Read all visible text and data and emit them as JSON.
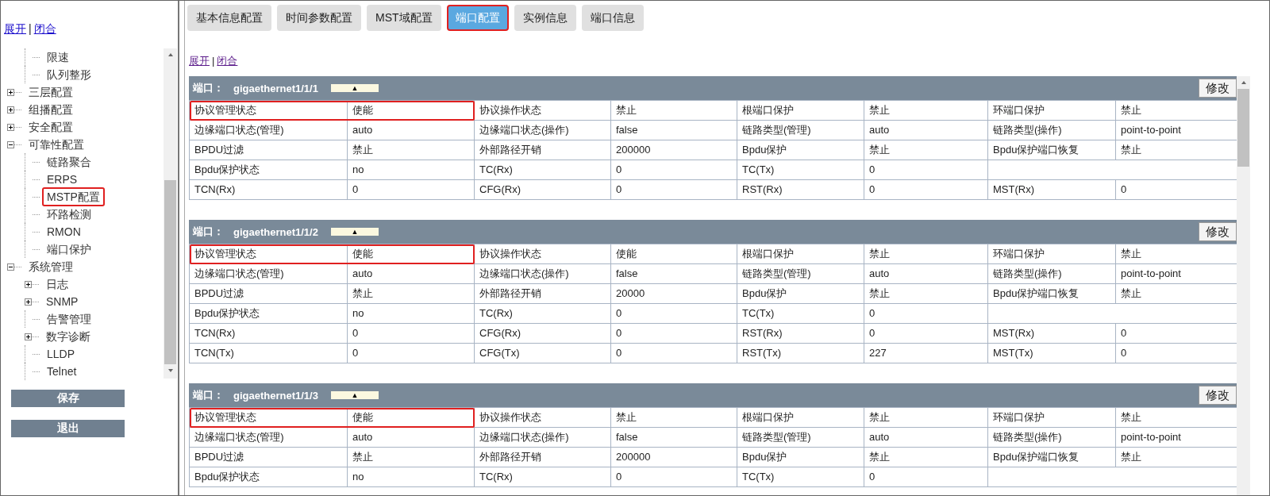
{
  "sidebar": {
    "links": [
      "展开",
      "闭合"
    ],
    "separator": "|",
    "tree": [
      {
        "children": [
          {
            "label": "限速",
            "highlighted": false
          },
          {
            "label": "队列整形",
            "highlighted": false
          }
        ]
      },
      {
        "label": "三层配置",
        "expanded": false,
        "highlighted": false
      },
      {
        "label": "组播配置",
        "expanded": false,
        "highlighted": false
      },
      {
        "label": "安全配置",
        "expanded": false,
        "highlighted": false
      },
      {
        "label": "可靠性配置",
        "expanded": true,
        "highlighted": false,
        "children": [
          {
            "label": "链路聚合",
            "highlighted": false
          },
          {
            "label": "ERPS",
            "highlighted": false
          },
          {
            "label": "MSTP配置",
            "highlighted": true
          },
          {
            "label": "环路检测",
            "highlighted": false
          },
          {
            "label": "RMON",
            "highlighted": false
          },
          {
            "label": "端口保护",
            "highlighted": false
          }
        ]
      },
      {
        "label": "系统管理",
        "expanded": true,
        "highlighted": false,
        "children": [
          {
            "label": "日志",
            "expanded": false,
            "highlighted": false
          },
          {
            "label": "SNMP",
            "expanded": false,
            "highlighted": false
          },
          {
            "label": "告警管理",
            "highlighted": false
          },
          {
            "label": "数字诊断",
            "expanded": false,
            "highlighted": false
          },
          {
            "label": "LLDP",
            "highlighted": false
          },
          {
            "label": "Telnet",
            "highlighted": false
          }
        ]
      }
    ],
    "buttons": [
      "保存",
      "退出"
    ]
  },
  "tabs": [
    {
      "label": "基本信息配置",
      "selected": false,
      "highlighted": false
    },
    {
      "label": "时间参数配置",
      "selected": false,
      "highlighted": false
    },
    {
      "label": "MST域配置",
      "selected": false,
      "highlighted": false
    },
    {
      "label": "端口配置",
      "selected": true,
      "highlighted": true
    },
    {
      "label": "实例信息",
      "selected": false,
      "highlighted": false
    },
    {
      "label": "端口信息",
      "selected": false,
      "highlighted": false
    }
  ],
  "links": [
    "展开",
    "闭合"
  ],
  "separator": "|",
  "ports": [
    {
      "label": "端口：",
      "name": "gigaethernet1/1/1",
      "toggle": "▲",
      "action": "修改",
      "rows": [
        {
          "highlighted": true,
          "cells": [
            "协议管理状态",
            "使能",
            "协议操作状态",
            "禁止",
            "根端口保护",
            "禁止",
            "环端口保护",
            "禁止"
          ]
        },
        {
          "highlighted": false,
          "cells": [
            "边缘端口状态(管理)",
            "auto",
            "边缘端口状态(操作)",
            "false",
            "链路类型(管理)",
            "auto",
            "链路类型(操作)",
            "point-to-point"
          ]
        },
        {
          "highlighted": false,
          "cells": [
            "BPDU过滤",
            "禁止",
            "外部路径开销",
            "200000",
            "Bpdu保护",
            "禁止",
            "Bpdu保护端口恢复",
            "禁止"
          ]
        },
        {
          "highlighted": false,
          "cells": [
            "Bpdu保护状态",
            "no",
            "TC(Rx)",
            "0",
            "TC(Tx)",
            "0"
          ]
        },
        {
          "highlighted": false,
          "cells": [
            "TCN(Rx)",
            "0",
            "CFG(Rx)",
            "0",
            "RST(Rx)",
            "0",
            "MST(Rx)",
            "0"
          ]
        }
      ]
    },
    {
      "label": "端口：",
      "name": "gigaethernet1/1/2",
      "toggle": "▲",
      "action": "修改",
      "rows": [
        {
          "highlighted": true,
          "cells": [
            "协议管理状态",
            "使能",
            "协议操作状态",
            "使能",
            "根端口保护",
            "禁止",
            "环端口保护",
            "禁止"
          ]
        },
        {
          "highlighted": false,
          "cells": [
            "边缘端口状态(管理)",
            "auto",
            "边缘端口状态(操作)",
            "false",
            "链路类型(管理)",
            "auto",
            "链路类型(操作)",
            "point-to-point"
          ]
        },
        {
          "highlighted": false,
          "cells": [
            "BPDU过滤",
            "禁止",
            "外部路径开销",
            "20000",
            "Bpdu保护",
            "禁止",
            "Bpdu保护端口恢复",
            "禁止"
          ]
        },
        {
          "highlighted": false,
          "cells": [
            "Bpdu保护状态",
            "no",
            "TC(Rx)",
            "0",
            "TC(Tx)",
            "0"
          ]
        },
        {
          "highlighted": false,
          "cells": [
            "TCN(Rx)",
            "0",
            "CFG(Rx)",
            "0",
            "RST(Rx)",
            "0",
            "MST(Rx)",
            "0"
          ]
        },
        {
          "highlighted": false,
          "cells": [
            "TCN(Tx)",
            "0",
            "CFG(Tx)",
            "0",
            "RST(Tx)",
            "227",
            "MST(Tx)",
            "0"
          ]
        }
      ]
    },
    {
      "label": "端口：",
      "name": "gigaethernet1/1/3",
      "toggle": "▲",
      "action": "修改",
      "rows": [
        {
          "highlighted": true,
          "cells": [
            "协议管理状态",
            "使能",
            "协议操作状态",
            "禁止",
            "根端口保护",
            "禁止",
            "环端口保护",
            "禁止"
          ]
        },
        {
          "highlighted": false,
          "cells": [
            "边缘端口状态(管理)",
            "auto",
            "边缘端口状态(操作)",
            "false",
            "链路类型(管理)",
            "auto",
            "链路类型(操作)",
            "point-to-point"
          ]
        },
        {
          "highlighted": false,
          "cells": [
            "BPDU过滤",
            "禁止",
            "外部路径开销",
            "200000",
            "Bpdu保护",
            "禁止",
            "Bpdu保护端口恢复",
            "禁止"
          ]
        },
        {
          "highlighted": false,
          "cells": [
            "Bpdu保护状态",
            "no",
            "TC(Rx)",
            "0",
            "TC(Tx)",
            "0"
          ]
        }
      ]
    }
  ]
}
